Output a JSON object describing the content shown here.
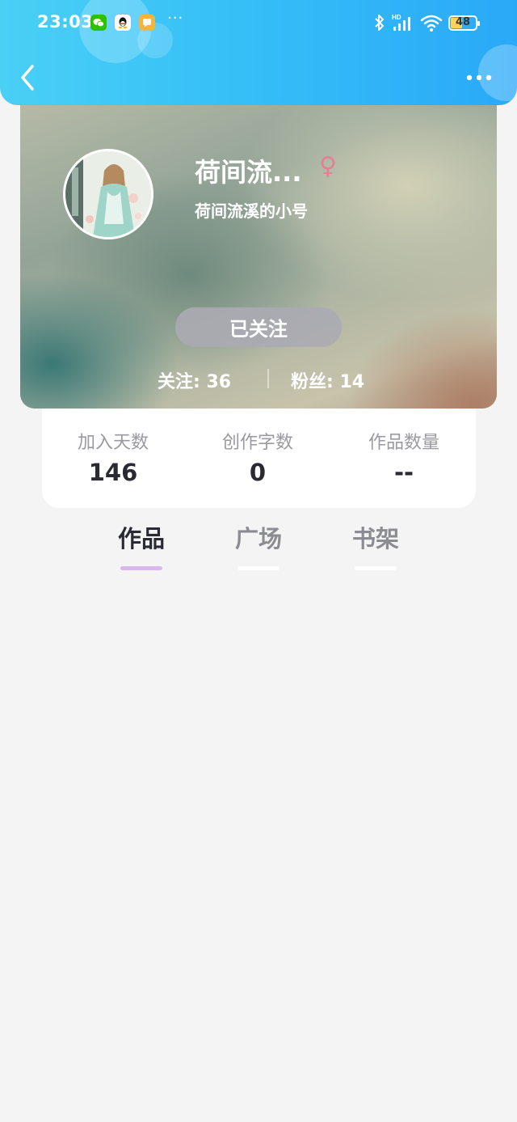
{
  "status_bar": {
    "time": "23:03",
    "notification_icons": [
      "wechat-icon",
      "qq-icon",
      "message-icon"
    ],
    "more_indicator": "···",
    "hd_label": "HD",
    "battery": "48"
  },
  "nav": {
    "back_icon": "chevron-left-icon",
    "more_icon": "more-dots-icon"
  },
  "profile": {
    "name": "荷间流...",
    "gender_symbol": "♀",
    "subtitle": "荷间流溪的小号",
    "follow_button": "已关注",
    "following": "关注: 36",
    "fans": "粉丝: 14"
  },
  "stats": [
    {
      "label": "加入天数",
      "value": "146"
    },
    {
      "label": "创作字数",
      "value": "0"
    },
    {
      "label": "作品数量",
      "value": "--"
    }
  ],
  "tabs": [
    {
      "label": "作品",
      "active": true
    },
    {
      "label": "广场",
      "active": false
    },
    {
      "label": "书架",
      "active": false
    }
  ],
  "colors": {
    "header_start": "#4ad0f5",
    "header_end": "#2aa9f7",
    "tab_indicator": "#d8b8ea",
    "gender": "#e57f94"
  }
}
